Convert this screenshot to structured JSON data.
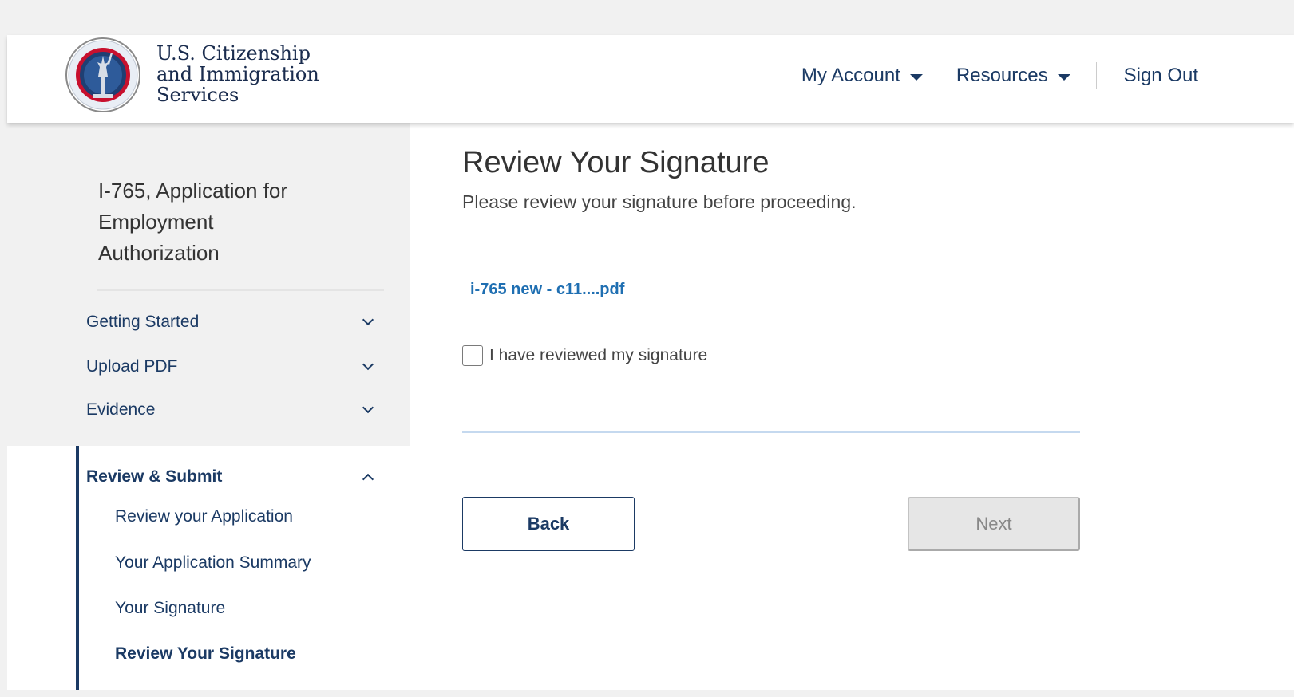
{
  "header": {
    "agency_lines": [
      "U.S. Citizenship",
      "and Immigration",
      "Services"
    ],
    "nav": {
      "my_account": "My Account",
      "resources": "Resources",
      "sign_out": "Sign Out"
    }
  },
  "sidebar": {
    "form_title": "I-765, Application for Employment Authorization",
    "sections": [
      {
        "label": "Getting Started",
        "expanded": false
      },
      {
        "label": "Upload PDF",
        "expanded": false
      },
      {
        "label": "Evidence",
        "expanded": false
      }
    ],
    "active_section": {
      "label": "Review & Submit",
      "expanded": true,
      "items": [
        "Review your Application",
        "Your Application Summary",
        "Your Signature",
        "Review Your Signature"
      ],
      "current_item": "Review Your Signature"
    }
  },
  "main": {
    "title": "Review Your Signature",
    "subtitle": "Please review your signature before proceeding.",
    "file_link": "i-765 new - c11....pdf",
    "checkbox_label": "I have reviewed my signature",
    "checkbox_checked": false,
    "back_label": "Back",
    "next_label": "Next",
    "next_disabled": true
  },
  "colors": {
    "navy": "#1b3a64",
    "link_blue": "#1f6fb2",
    "sidebar_bg": "#f1f1f1",
    "disabled_bg": "#e6e6e6"
  },
  "icons": [
    "uscis-seal-logo",
    "caret-down-icon",
    "chevron-down-icon",
    "chevron-up-icon"
  ]
}
